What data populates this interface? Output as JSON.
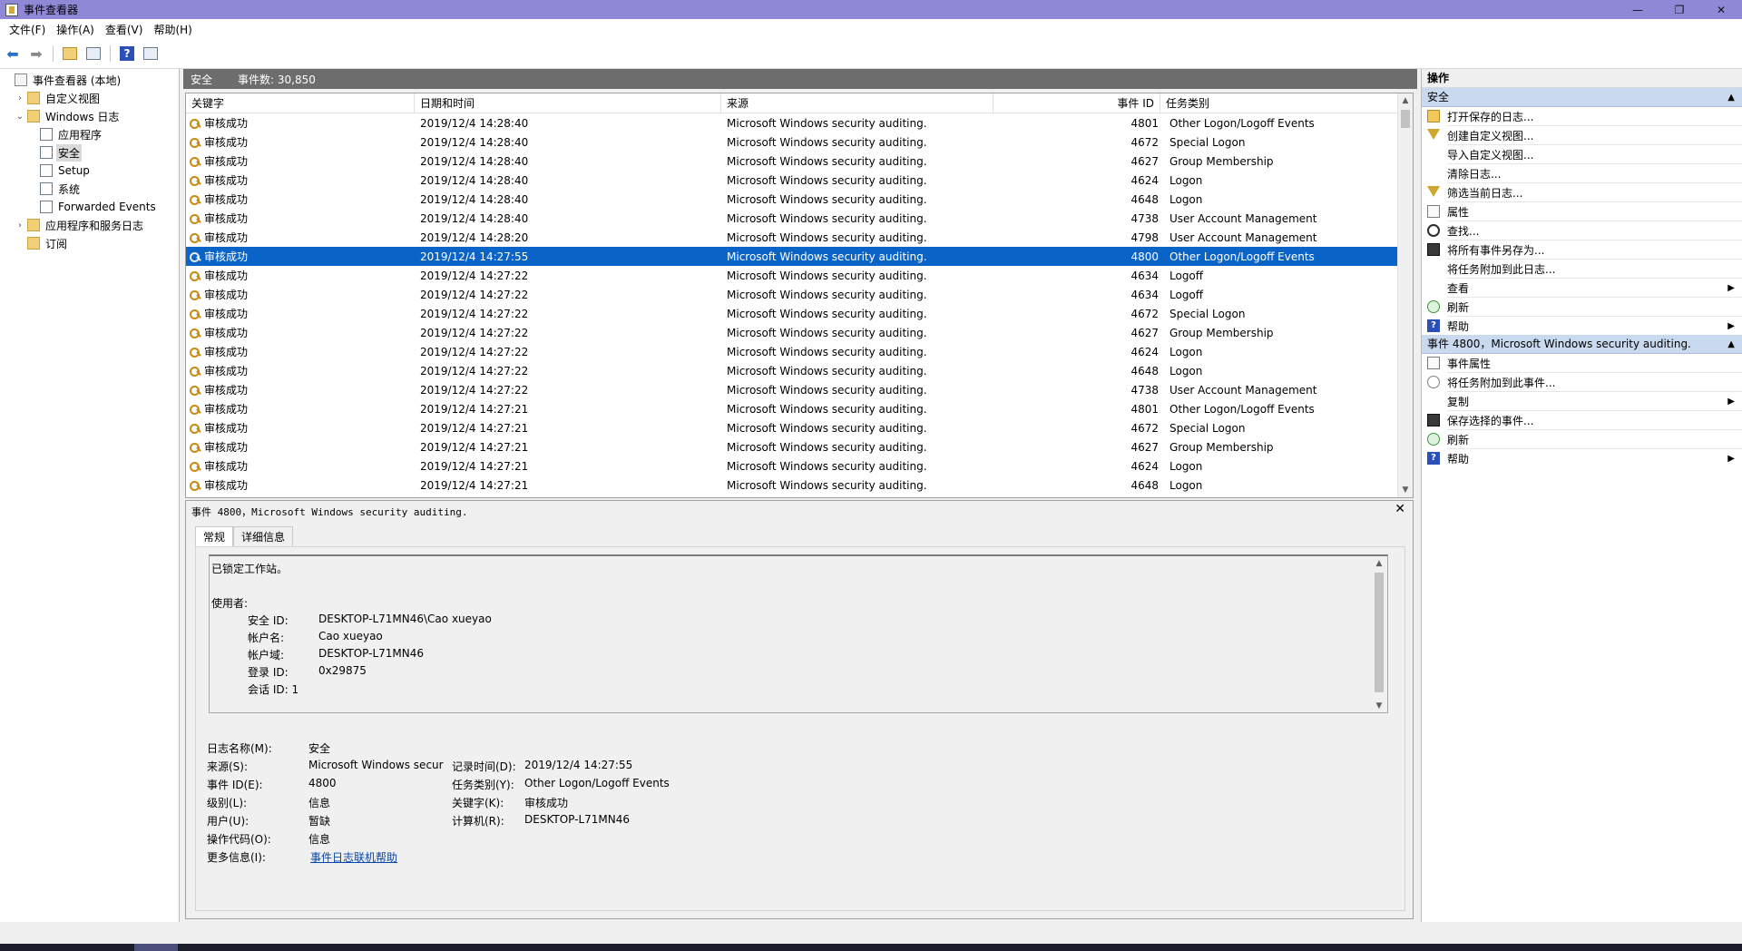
{
  "window": {
    "title": "事件查看器",
    "controls": [
      "—",
      "❐",
      "✕"
    ]
  },
  "menu": [
    "文件(F)",
    "操作(A)",
    "查看(V)",
    "帮助(H)"
  ],
  "toolbar": {
    "icons": [
      "back-arrow-icon",
      "forward-arrow-icon",
      "folder-up-icon",
      "console-tree-icon",
      "help-icon",
      "action-pane-icon"
    ]
  },
  "tree": {
    "items": [
      {
        "label": "事件查看器 (本地)",
        "level": 0,
        "arrow": "",
        "icon": "computer"
      },
      {
        "label": "自定义视图",
        "level": 1,
        "arrow": "›",
        "icon": "folder"
      },
      {
        "label": "Windows 日志",
        "level": 1,
        "arrow": "⌄",
        "icon": "folder"
      },
      {
        "label": "应用程序",
        "level": 2,
        "arrow": "",
        "icon": "log"
      },
      {
        "label": "安全",
        "level": 2,
        "arrow": "",
        "icon": "log",
        "selected": true
      },
      {
        "label": "Setup",
        "level": 2,
        "arrow": "",
        "icon": "log"
      },
      {
        "label": "系统",
        "level": 2,
        "arrow": "",
        "icon": "log"
      },
      {
        "label": "Forwarded Events",
        "level": 2,
        "arrow": "",
        "icon": "log"
      },
      {
        "label": "应用程序和服务日志",
        "level": 1,
        "arrow": "›",
        "icon": "folder"
      },
      {
        "label": "订阅",
        "level": 1,
        "arrow": "",
        "icon": "folder"
      }
    ]
  },
  "center": {
    "log_name": "安全",
    "event_count": "事件数: 30,850",
    "columns": [
      "关键字",
      "日期和时间",
      "来源",
      "事件 ID",
      "任务类别"
    ],
    "rows": [
      [
        "审核成功",
        "2019/12/4 14:28:40",
        "Microsoft Windows security auditing.",
        "4801",
        "Other Logon/Logoff Events"
      ],
      [
        "审核成功",
        "2019/12/4 14:28:40",
        "Microsoft Windows security auditing.",
        "4672",
        "Special Logon"
      ],
      [
        "审核成功",
        "2019/12/4 14:28:40",
        "Microsoft Windows security auditing.",
        "4627",
        "Group Membership"
      ],
      [
        "审核成功",
        "2019/12/4 14:28:40",
        "Microsoft Windows security auditing.",
        "4624",
        "Logon"
      ],
      [
        "审核成功",
        "2019/12/4 14:28:40",
        "Microsoft Windows security auditing.",
        "4648",
        "Logon"
      ],
      [
        "审核成功",
        "2019/12/4 14:28:40",
        "Microsoft Windows security auditing.",
        "4738",
        "User Account Management"
      ],
      [
        "审核成功",
        "2019/12/4 14:28:20",
        "Microsoft Windows security auditing.",
        "4798",
        "User Account Management"
      ],
      [
        "审核成功",
        "2019/12/4 14:27:55",
        "Microsoft Windows security auditing.",
        "4800",
        "Other Logon/Logoff Events"
      ],
      [
        "审核成功",
        "2019/12/4 14:27:22",
        "Microsoft Windows security auditing.",
        "4634",
        "Logoff"
      ],
      [
        "审核成功",
        "2019/12/4 14:27:22",
        "Microsoft Windows security auditing.",
        "4634",
        "Logoff"
      ],
      [
        "审核成功",
        "2019/12/4 14:27:22",
        "Microsoft Windows security auditing.",
        "4672",
        "Special Logon"
      ],
      [
        "审核成功",
        "2019/12/4 14:27:22",
        "Microsoft Windows security auditing.",
        "4627",
        "Group Membership"
      ],
      [
        "审核成功",
        "2019/12/4 14:27:22",
        "Microsoft Windows security auditing.",
        "4624",
        "Logon"
      ],
      [
        "审核成功",
        "2019/12/4 14:27:22",
        "Microsoft Windows security auditing.",
        "4648",
        "Logon"
      ],
      [
        "审核成功",
        "2019/12/4 14:27:22",
        "Microsoft Windows security auditing.",
        "4738",
        "User Account Management"
      ],
      [
        "审核成功",
        "2019/12/4 14:27:21",
        "Microsoft Windows security auditing.",
        "4801",
        "Other Logon/Logoff Events"
      ],
      [
        "审核成功",
        "2019/12/4 14:27:21",
        "Microsoft Windows security auditing.",
        "4672",
        "Special Logon"
      ],
      [
        "审核成功",
        "2019/12/4 14:27:21",
        "Microsoft Windows security auditing.",
        "4627",
        "Group Membership"
      ],
      [
        "审核成功",
        "2019/12/4 14:27:21",
        "Microsoft Windows security auditing.",
        "4624",
        "Logon"
      ],
      [
        "审核成功",
        "2019/12/4 14:27:21",
        "Microsoft Windows security auditing.",
        "4648",
        "Logon"
      ]
    ],
    "selected_row": 7
  },
  "detail": {
    "title": "事件 4800，Microsoft Windows security auditing.",
    "tabs": [
      "常规",
      "详细信息"
    ],
    "message": {
      "line1": "已锁定工作站。",
      "subject_label": "使用者:",
      "fields": [
        {
          "label": "安全 ID:",
          "value": "DESKTOP-L71MN46\\Cao xueyao"
        },
        {
          "label": "帐户名:",
          "value": "Cao xueyao"
        },
        {
          "label": "帐户域:",
          "value": "DESKTOP-L71MN46"
        },
        {
          "label": "登录 ID:",
          "value": "0x29875"
        }
      ],
      "cut_line": "会话 ID: 1"
    },
    "props": {
      "log_name_label": "日志名称(M):",
      "log_name": "安全",
      "source_label": "来源(S):",
      "source": "Microsoft Windows secur",
      "recorded_label": "记录时间(D):",
      "recorded": "2019/12/4 14:27:55",
      "event_id_label": "事件 ID(E):",
      "event_id": "4800",
      "task_label": "任务类别(Y):",
      "task": "Other Logon/Logoff Events",
      "level_label": "级别(L):",
      "level": "信息",
      "keywords_label": "关键字(K):",
      "keywords": "审核成功",
      "user_label": "用户(U):",
      "user": "暂缺",
      "computer_label": "计算机(R):",
      "computer": "DESKTOP-L71MN46",
      "opcode_label": "操作代码(O):",
      "opcode": "信息",
      "more_label": "更多信息(I):",
      "more_link": "事件日志联机帮助"
    }
  },
  "actions": {
    "title": "操作",
    "section1": "安全",
    "items1": [
      {
        "label": "打开保存的日志...",
        "icon": "open-log-icon"
      },
      {
        "label": "创建自定义视图...",
        "icon": "filter-create-icon"
      },
      {
        "label": "导入自定义视图...",
        "icon": ""
      },
      {
        "label": "清除日志...",
        "icon": ""
      },
      {
        "label": "筛选当前日志...",
        "icon": "filter-icon"
      },
      {
        "label": "属性",
        "icon": "properties-icon"
      },
      {
        "label": "查找...",
        "icon": "find-icon"
      },
      {
        "label": "将所有事件另存为...",
        "icon": "save-icon"
      },
      {
        "label": "将任务附加到此日志...",
        "icon": ""
      },
      {
        "label": "查看",
        "icon": "",
        "more": true
      },
      {
        "label": "刷新",
        "icon": "refresh-icon"
      },
      {
        "label": "帮助",
        "icon": "help-icon",
        "more": true
      }
    ],
    "section2": "事件 4800，Microsoft Windows security auditing.",
    "items2": [
      {
        "label": "事件属性",
        "icon": "event-properties-icon"
      },
      {
        "label": "将任务附加到此事件...",
        "icon": "task-icon"
      },
      {
        "label": "复制",
        "icon": "copy-icon",
        "more": true
      },
      {
        "label": "保存选择的事件...",
        "icon": "save-icon"
      },
      {
        "label": "刷新",
        "icon": "refresh-icon"
      },
      {
        "label": "帮助",
        "icon": "help-icon",
        "more": true
      }
    ]
  },
  "colors": {
    "titlebar": "#8f88d7",
    "selection": "#0a64c8",
    "header_bar": "#6d6d6d",
    "action_section": "#c9daf0"
  }
}
